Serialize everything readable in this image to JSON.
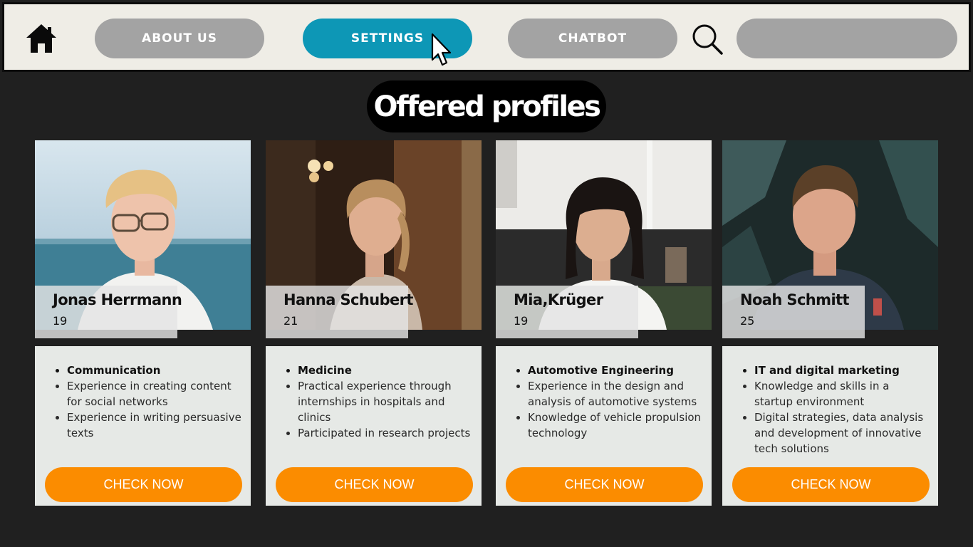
{
  "nav": {
    "home_icon": "home-icon",
    "about_label": "ABOUT US",
    "settings_label": "SETTINGS",
    "chatbot_label": "CHATBOT",
    "search_icon": "search-icon",
    "search_value": "",
    "active_color": "#0d97b6",
    "inactive_color": "#a3a3a3"
  },
  "heading": "Offered profiles",
  "accent_color": "#fb8c00",
  "profiles": [
    {
      "name": "Jonas Herrmann",
      "age": "19",
      "bullets": [
        "Communication",
        "Experience in creating content for social networks",
        "Experience in writing persuasive texts"
      ],
      "button": "CHECK NOW"
    },
    {
      "name": "Hanna Schubert",
      "age": "21",
      "bullets": [
        "Medicine",
        "Practical experience through internships in hospitals and clinics",
        "Participated in research projects"
      ],
      "button": "CHECK NOW"
    },
    {
      "name": "Mia,Krüger",
      "age": "19",
      "bullets": [
        "Automotive Engineering",
        "Experience in the design and analysis of automotive systems",
        "Knowledge of vehicle propulsion technology"
      ],
      "button": "CHECK NOW"
    },
    {
      "name": "Noah Schmitt",
      "age": "25",
      "bullets": [
        "IT and digital marketing",
        "Knowledge and skills in a startup environment",
        "Digital strategies, data analysis and development of innovative tech solutions"
      ],
      "button": "CHECK NOW"
    }
  ]
}
